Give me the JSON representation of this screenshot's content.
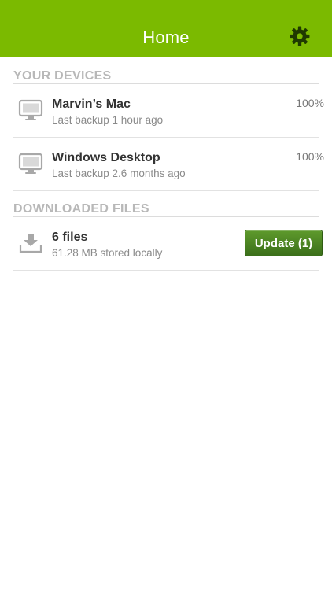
{
  "navbar": {
    "title": "Home",
    "settings_icon": "gear-icon",
    "background_color": "#7bba00"
  },
  "devices_section": {
    "header": "YOUR DEVICES",
    "items": [
      {
        "name": "Marvin’s Mac",
        "subtitle": "Last backup 1 hour ago",
        "percent": "100%",
        "icon": "monitor-icon"
      },
      {
        "name": "Windows Desktop",
        "subtitle": "Last backup 2.6 months ago",
        "percent": "100%",
        "icon": "monitor-icon"
      }
    ]
  },
  "downloads_section": {
    "header": "DOWNLOADED FILES",
    "item": {
      "title": "6 files",
      "subtitle": "61.28 MB stored locally",
      "icon": "download-icon",
      "button_label": "Update (1)",
      "button_color": "#4a8524"
    }
  }
}
